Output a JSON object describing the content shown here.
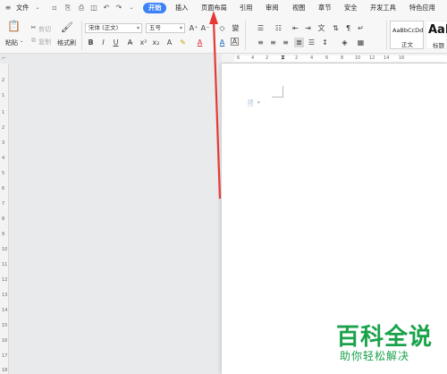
{
  "menubar": {
    "file_label": "文件",
    "tabs": [
      "开始",
      "插入",
      "页面布局",
      "引用",
      "审阅",
      "视图",
      "章节",
      "安全",
      "开发工具",
      "特色应用"
    ],
    "active_tab": "开始",
    "accent_color": "#3b82f6"
  },
  "ribbon": {
    "paste_label": "粘贴",
    "cut_label": "剪切",
    "copy_label": "复制",
    "format_painter_label": "格式刷",
    "font_name": "宋体 (正文)",
    "font_size": "五号",
    "styles": [
      {
        "preview": "AaBbCcDd",
        "label": "正文"
      },
      {
        "preview": "AaB",
        "label": "标题"
      }
    ]
  },
  "ruler": {
    "h_numbers": [
      "6",
      "4",
      "2",
      "2",
      "4",
      "6",
      "8",
      "10",
      "12",
      "14",
      "16"
    ],
    "v_numbers": [
      "2",
      "1",
      "1",
      "2",
      "3",
      "4",
      "5",
      "6",
      "7",
      "8",
      "9",
      "10",
      "11",
      "12",
      "13",
      "14",
      "15",
      "16",
      "17",
      "18"
    ]
  },
  "watermark": {
    "title": "百科全说",
    "subtitle": "助你轻松解决",
    "color": "#1aa24a"
  },
  "annotation": {
    "arrow_color": "#e53935"
  }
}
